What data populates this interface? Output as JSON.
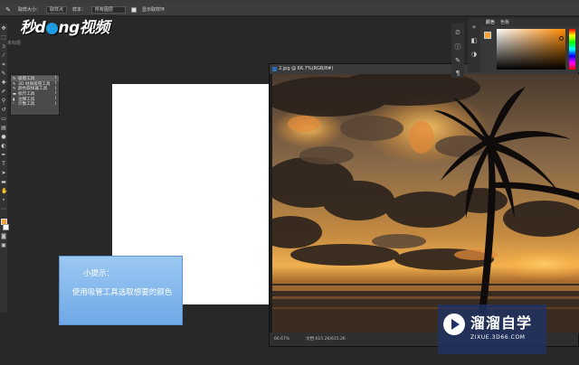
{
  "options_bar": {
    "sample_size_label": "取样大小：",
    "sample_size_value": "取样点",
    "sample_label": "样本：",
    "sample_value": "所有图层",
    "show_ring_label": "显示取样环"
  },
  "logo": {
    "part1": "秒",
    "part2": "d",
    "part3": "ng",
    "part4": "视频"
  },
  "doc_tab": "未标题",
  "flyout": {
    "items": [
      {
        "icon": "eyedropper-icon",
        "label": "吸管工具",
        "key": "I"
      },
      {
        "icon": "3d-material-eyedropper-icon",
        "label": "3D 材质吸管工具",
        "key": "I"
      },
      {
        "icon": "color-sampler-icon",
        "label": "颜色取样器工具",
        "key": "I"
      },
      {
        "icon": "ruler-icon",
        "label": "标尺工具",
        "key": "I"
      },
      {
        "icon": "note-icon",
        "label": "注释工具",
        "key": "I"
      },
      {
        "icon": "count-icon",
        "label": "计数工具",
        "key": "I"
      }
    ]
  },
  "photo_window": {
    "title": "2.jpg @ 66.7%(RGB/8#)",
    "zoom": "66.67%",
    "doc_info": "文档:615.2K/615.2K"
  },
  "color_panel": {
    "tab_color": "颜色",
    "tab_swatches": "色板",
    "foreground": "#f6a23a",
    "background": "#ffffff"
  },
  "tip": {
    "title": "小提示：",
    "body": "使用吸管工具选取想要的颜色"
  },
  "watermark": {
    "title": "溜溜自学",
    "url": "ZIXUE.3D66.COM"
  }
}
